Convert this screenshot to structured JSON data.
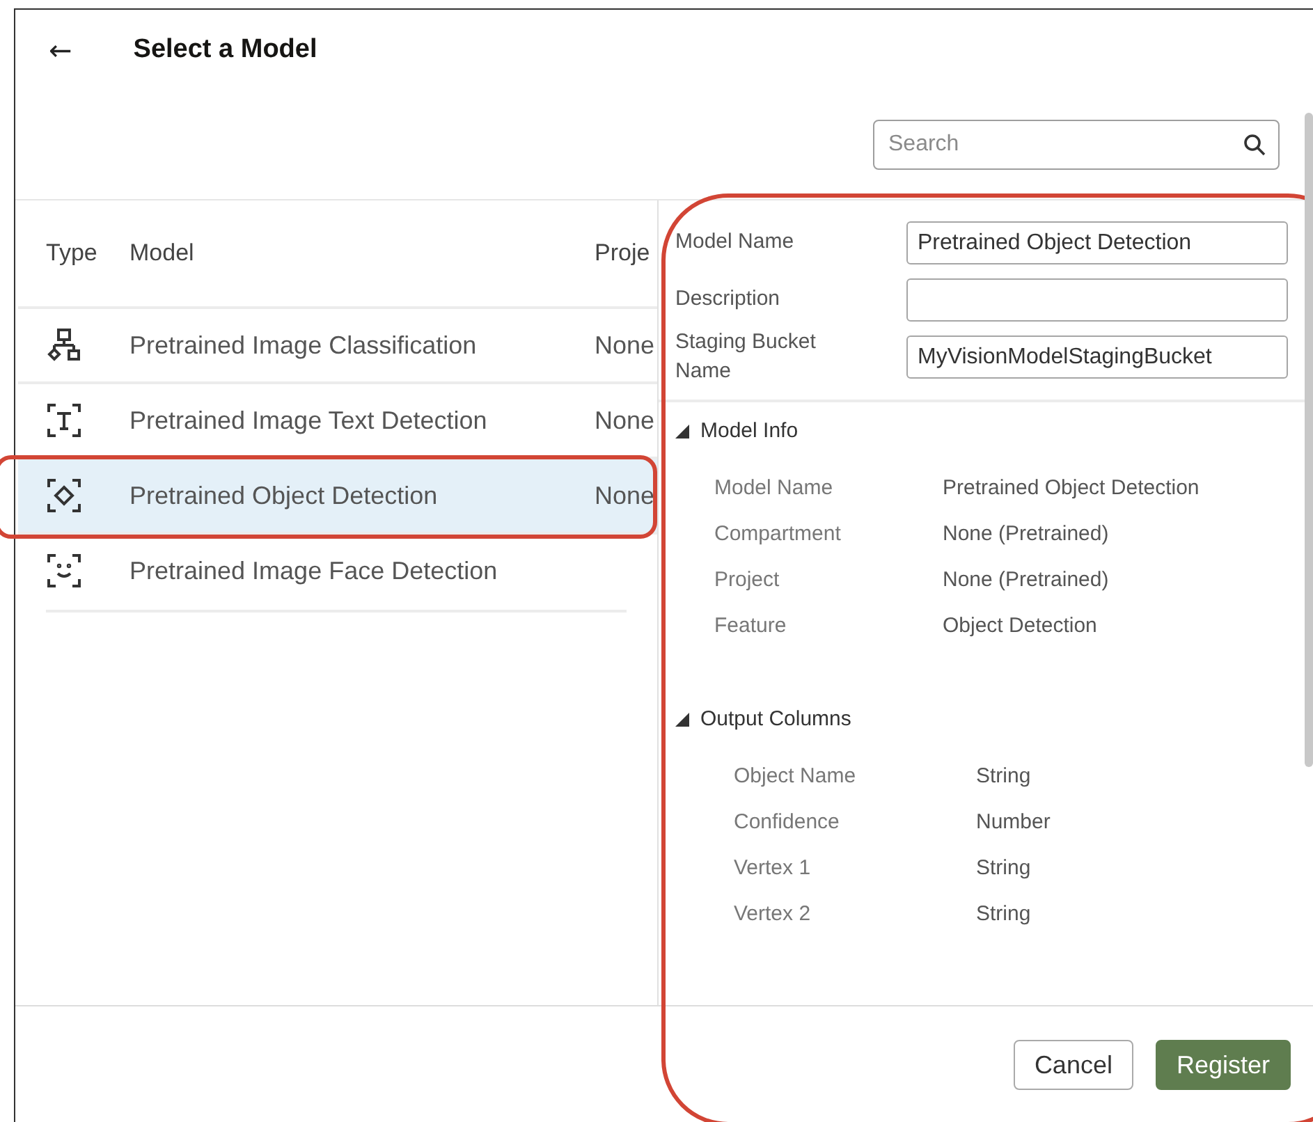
{
  "header": {
    "back": "←",
    "title": "Select a Model"
  },
  "search": {
    "placeholder": "Search"
  },
  "table": {
    "columns": [
      "Type",
      "Model",
      "Proje"
    ],
    "rows": [
      {
        "kind": "hierarchy",
        "model": "Pretrained Image Classification",
        "project": "None",
        "selected": false,
        "highlighted": false
      },
      {
        "kind": "text-frame",
        "model": "Pretrained Image Text Detection",
        "project": "None",
        "selected": false,
        "highlighted": false
      },
      {
        "kind": "object-frame",
        "model": "Pretrained Object Detection",
        "project": "None",
        "selected": true,
        "highlighted": true
      },
      {
        "kind": "face-frame",
        "model": "Pretrained Image Face Detection",
        "selected": false,
        "highlighted": false
      }
    ]
  },
  "details": {
    "highlighted": true,
    "fields": [
      {
        "label": "Model Name",
        "value": "Pretrained Object Detection"
      },
      {
        "label": "Description"
      },
      {
        "label": "Staging Bucket Name",
        "value": "MyVisionModelStagingBucket"
      }
    ],
    "sections": [
      {
        "title": "Model Info",
        "expanded": true,
        "rows": [
          {
            "label": "Model Name",
            "value": "Pretrained Object Detection"
          },
          {
            "label": "Compartment",
            "value": "None (Pretrained)"
          },
          {
            "label": "Project",
            "value": "None (Pretrained)"
          },
          {
            "label": "Feature",
            "value": "Object Detection"
          }
        ]
      },
      {
        "title": "Output Columns",
        "expanded": true,
        "rows": [
          {
            "label": "Object Name",
            "value": "String"
          },
          {
            "label": "Confidence",
            "value": "Number"
          },
          {
            "label": "Vertex 1",
            "value": "String"
          },
          {
            "label": "Vertex 2",
            "value": "String"
          }
        ]
      }
    ]
  },
  "buttons": [
    {
      "kind": "secondary",
      "label": "Cancel"
    },
    {
      "kind": "primary",
      "label": "Register"
    }
  ]
}
